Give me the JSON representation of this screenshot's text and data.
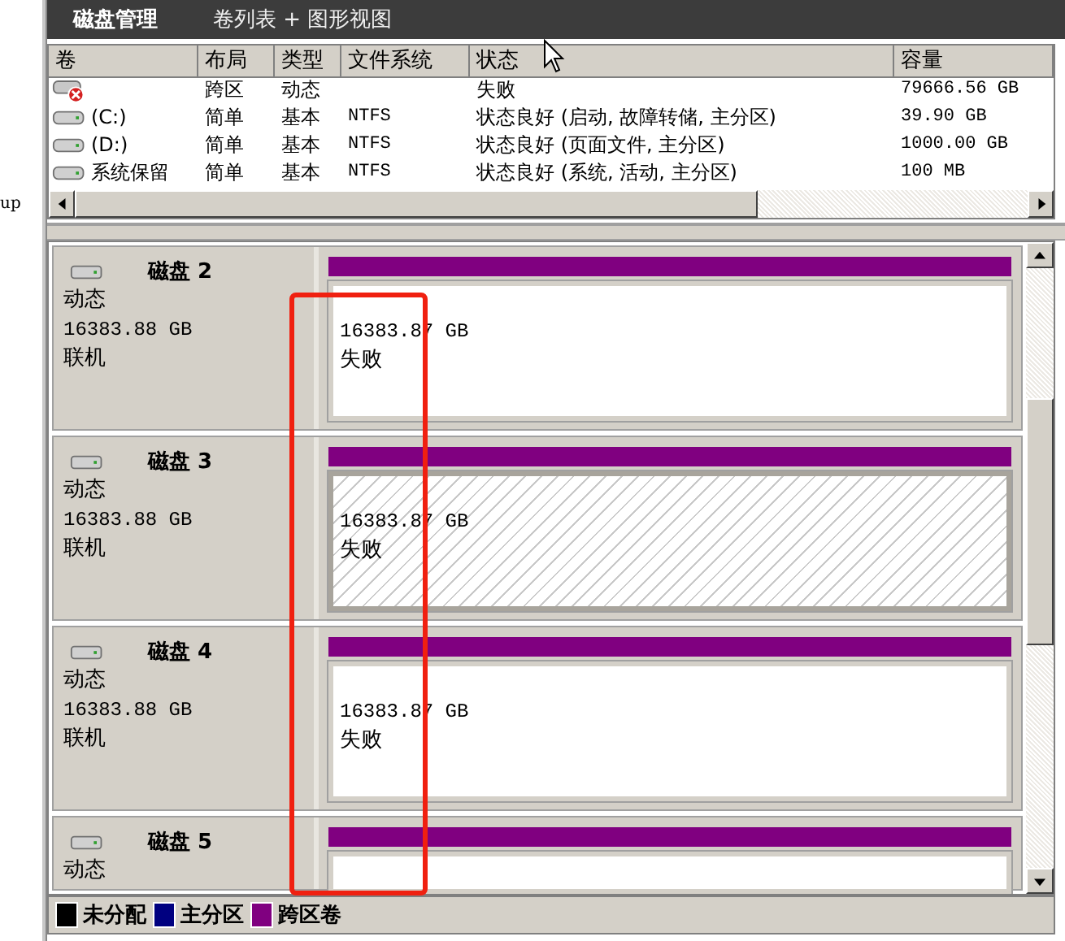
{
  "header": {
    "title": "磁盘管理",
    "view": "卷列表 + 图形视图"
  },
  "side_fragment": "up",
  "table": {
    "columns": [
      "卷",
      "布局",
      "类型",
      "文件系统",
      "状态",
      "容量"
    ],
    "rows": [
      {
        "kind": "failed",
        "layout": "跨区",
        "type": "动态",
        "status": "失败",
        "capacity": "79666.56 GB"
      },
      {
        "kind": "ok",
        "volume": "(C:)",
        "layout": "简单",
        "type": "基本",
        "fs": "NTFS",
        "status": "状态良好 (启动, 故障转储, 主分区)",
        "capacity": "39.90 GB"
      },
      {
        "kind": "ok",
        "volume": "(D:)",
        "layout": "简单",
        "type": "基本",
        "fs": "NTFS",
        "status": "状态良好 (页面文件, 主分区)",
        "capacity": "1000.00 GB"
      },
      {
        "kind": "ok",
        "volume": "系统保留",
        "layout": "简单",
        "type": "基本",
        "fs": "NTFS",
        "status": "状态良好 (系统, 活动, 主分区)",
        "capacity": "100 MB"
      }
    ]
  },
  "disks": [
    {
      "name": "磁盘 2",
      "type": "动态",
      "size": "16383.88 GB",
      "state": "联机",
      "volume": {
        "size": "16383.87 GB",
        "status": "失败",
        "selected": false
      }
    },
    {
      "name": "磁盘 3",
      "type": "动态",
      "size": "16383.88 GB",
      "state": "联机",
      "volume": {
        "size": "16383.87 GB",
        "status": "失败",
        "selected": true
      }
    },
    {
      "name": "磁盘 4",
      "type": "动态",
      "size": "16383.88 GB",
      "state": "联机",
      "volume": {
        "size": "16383.87 GB",
        "status": "失败",
        "selected": false
      }
    },
    {
      "name": "磁盘 5",
      "type": "动态",
      "volume": {
        "selected": false
      }
    }
  ],
  "legend": [
    {
      "label": "未分配",
      "color": "#000000"
    },
    {
      "label": "主分区",
      "color": "#000080"
    },
    {
      "label": "跨区卷",
      "color": "#800080"
    }
  ]
}
